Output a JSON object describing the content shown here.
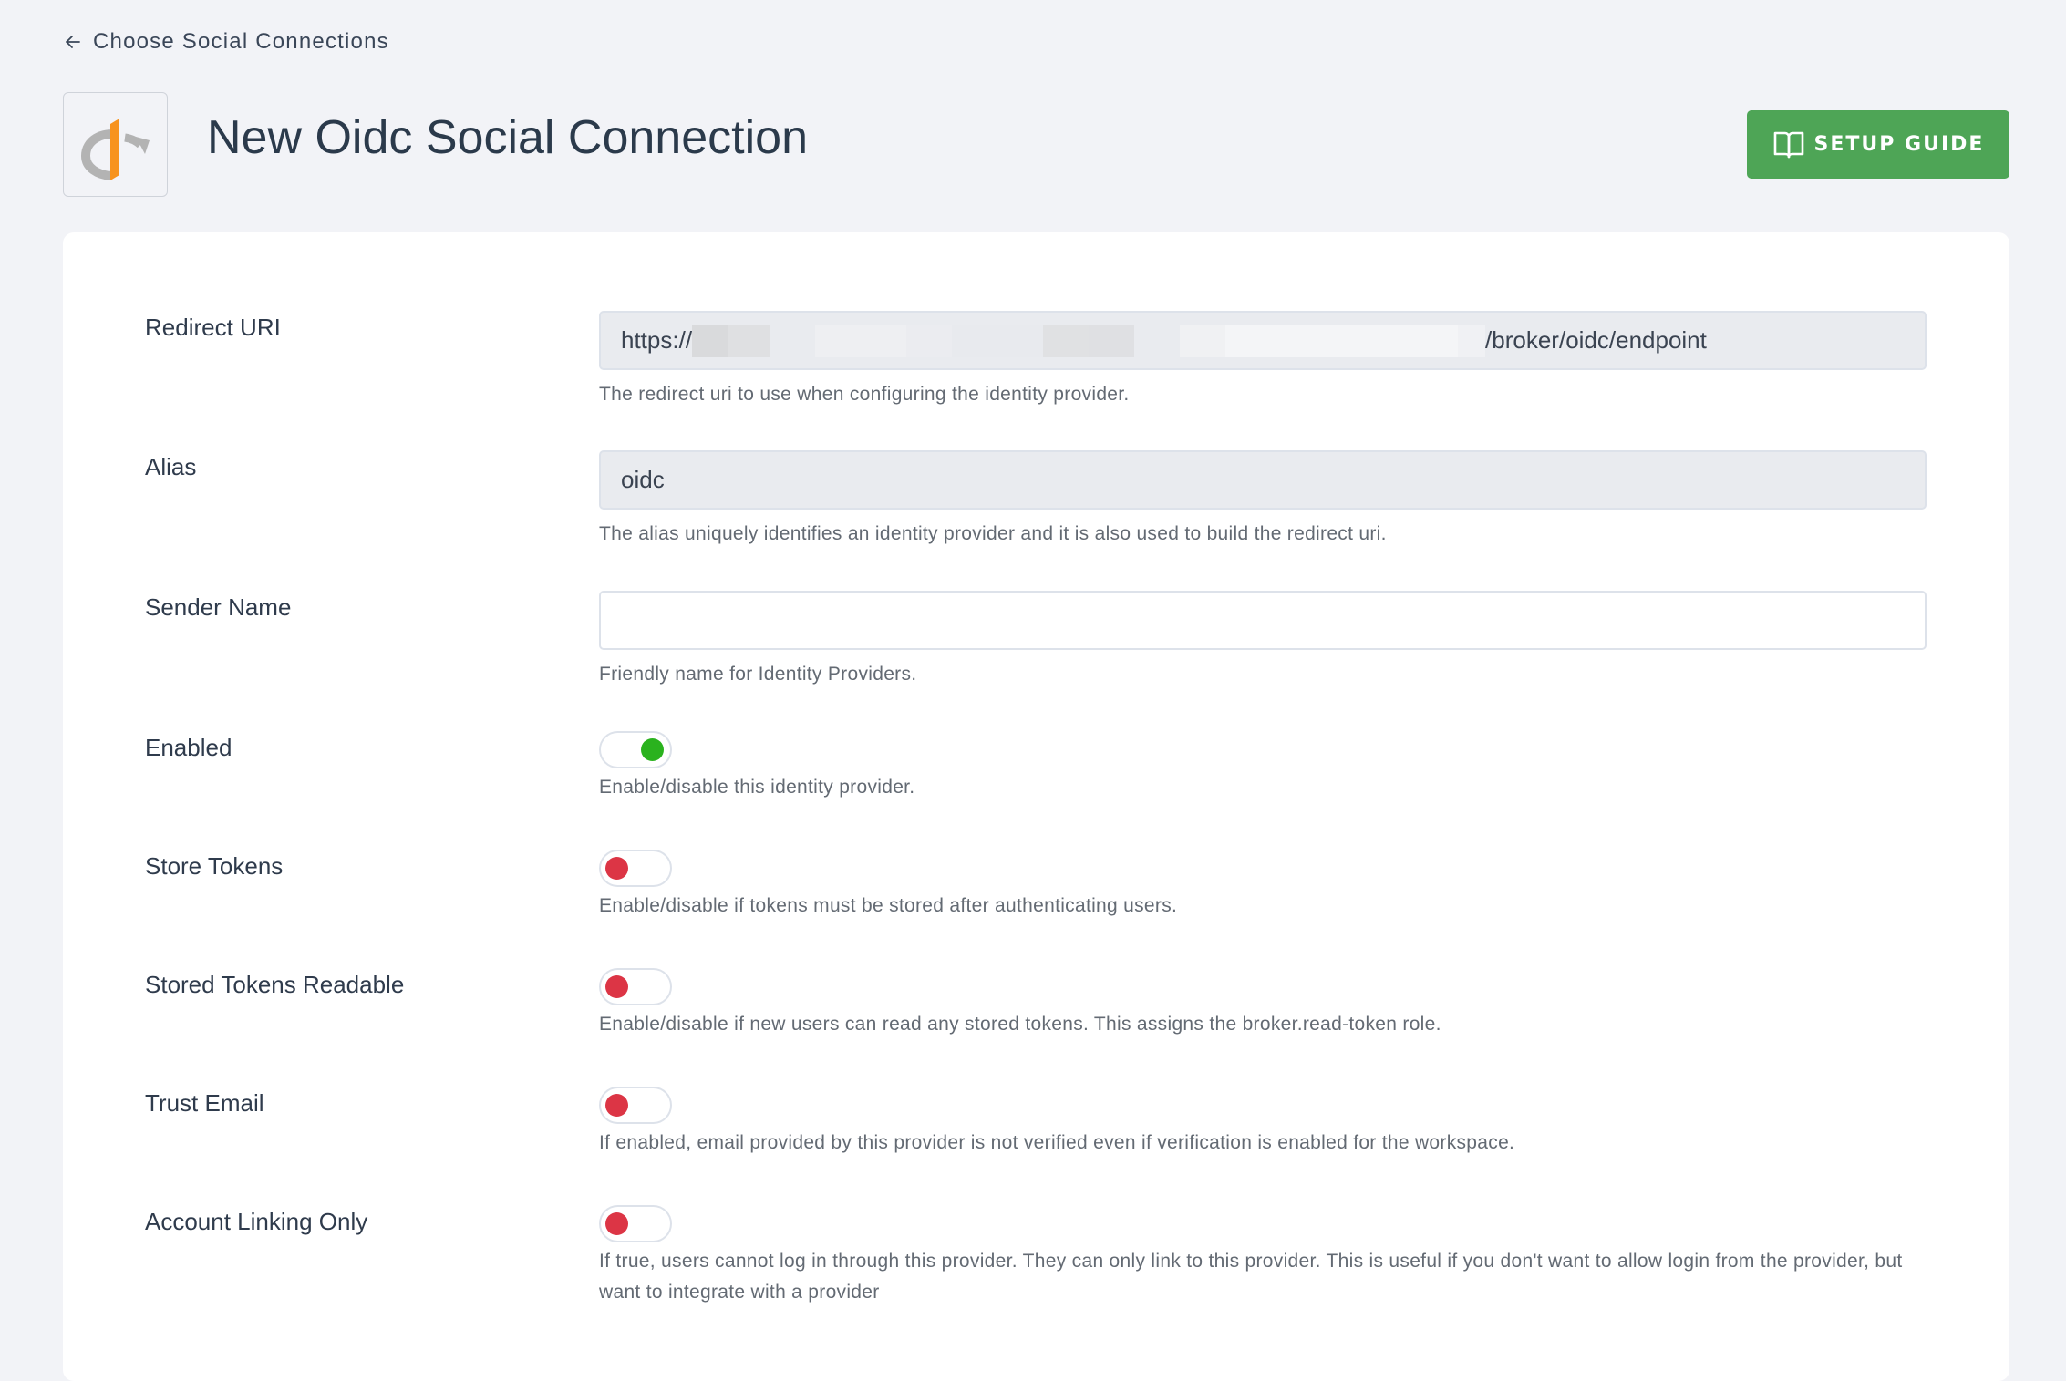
{
  "breadcrumb": {
    "label": "Choose Social Connections",
    "icon": "arrow-left-icon"
  },
  "header": {
    "title": "New Oidc Social Connection",
    "logo": "openid-logo",
    "setup_guide_label": "SETUP GUIDE",
    "setup_guide_icon": "book-open-icon",
    "accent": "#4ea556"
  },
  "form": {
    "redirect_uri": {
      "label": "Redirect URI",
      "value_prefix": "https://",
      "value_redacted": true,
      "value_suffix": "/broker/oidc/endpoint",
      "helper": "The redirect uri to use when configuring the identity provider."
    },
    "alias": {
      "label": "Alias",
      "value": "oidc",
      "helper": "The alias uniquely identifies an identity provider and it is also used to build the redirect uri."
    },
    "sender_name": {
      "label": "Sender Name",
      "value": "",
      "placeholder": "",
      "helper": "Friendly name for Identity Providers."
    },
    "toggles": [
      {
        "label": "Enabled",
        "on": true,
        "helper": "Enable/disable this identity provider."
      },
      {
        "label": "Store Tokens",
        "on": false,
        "helper": "Enable/disable if tokens must be stored after authenticating users."
      },
      {
        "label": "Stored Tokens Readable",
        "on": false,
        "helper": "Enable/disable if new users can read any stored tokens. This assigns the broker.read-token role."
      },
      {
        "label": "Trust Email",
        "on": false,
        "helper": "If enabled, email provided by this provider is not verified even if verification is enabled for the workspace."
      },
      {
        "label": "Account Linking Only",
        "on": false,
        "helper": "If true, users cannot log in through this provider. They can only link to this provider. This is useful if you don't want to allow login from the provider, but want to integrate with a provider"
      }
    ],
    "colors": {
      "toggle_on": "#2ab21e",
      "toggle_off": "#dc3545"
    }
  }
}
